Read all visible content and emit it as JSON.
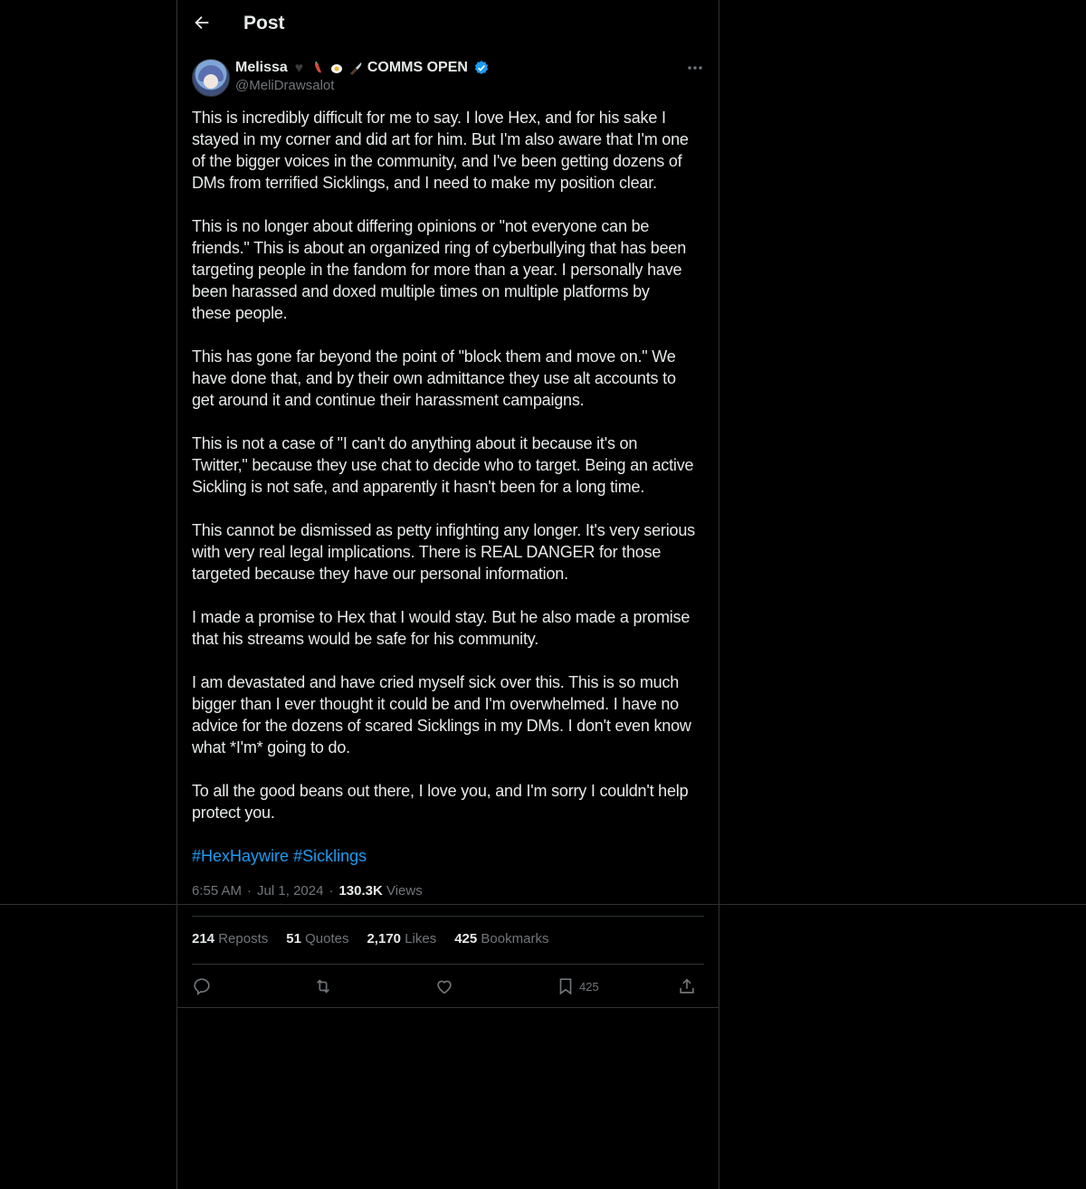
{
  "header": {
    "title": "Post"
  },
  "author": {
    "name": "Melissa",
    "name_suffix": "COMMS OPEN",
    "handle": "@MeliDrawsalot",
    "emojis": [
      "black-heart",
      "chili-pepper",
      "fried-egg",
      "kitchen-knife"
    ],
    "verified": true
  },
  "post": {
    "body": "This is incredibly difficult for me to say. I love Hex, and for his sake I\nstayed in my corner and did art for him. But I'm also aware that I'm one\nof the bigger voices in the community, and I've been getting dozens of\nDMs from terrified Sicklings, and I need to make my position clear.\n\nThis is no longer about differing opinions or \"not everyone can be\nfriends.\" This is about an organized ring of cyberbullying that has been\ntargeting people in the fandom for more than a year. I personally have\nbeen harassed and doxed multiple times on multiple platforms by\nthese people.\n\nThis has gone far beyond the point of \"block them and move on.\" We\nhave done that, and by their own admittance they use alt accounts to\nget around it and continue their harassment campaigns.\n\nThis is not a case of \"I can't do anything about it because it's on\nTwitter,\" because they use chat to decide who to target. Being an active\nSickling is not safe, and apparently it hasn't been for a long time.\n\nThis cannot be dismissed as petty infighting any longer. It's very serious\nwith very real legal implications. There is REAL DANGER for those\ntargeted because they have our personal information.\n\nI made a promise to Hex that I would stay. But he also made a promise\nthat his streams would be safe for his community.\n\nI am devastated and have cried myself sick over this. This is so much\nbigger than I ever thought it could be and I'm overwhelmed. I have no\nadvice for the dozens of scared Sicklings in my DMs. I don't even know\nwhat *I'm* going to do.\n\nTo all the good beans out there, I love you, and I'm sorry I couldn't help\nprotect you.",
    "hashtags": [
      "#HexHaywire",
      "#Sicklings"
    ],
    "time": "6:55 AM",
    "date": "Jul 1, 2024",
    "views_count": "130.3K",
    "views_label": "Views"
  },
  "stats": {
    "reposts": {
      "count": "214",
      "label": "Reposts"
    },
    "quotes": {
      "count": "51",
      "label": "Quotes"
    },
    "likes": {
      "count": "2,170",
      "label": "Likes"
    },
    "bookmarks": {
      "count": "425",
      "label": "Bookmarks"
    }
  },
  "actions": {
    "bookmark_count": "425"
  },
  "colors": {
    "background": "#000000",
    "text": "#e7e9ea",
    "muted": "#71767b",
    "accent": "#1d9bf0",
    "border": "#2f3336"
  }
}
